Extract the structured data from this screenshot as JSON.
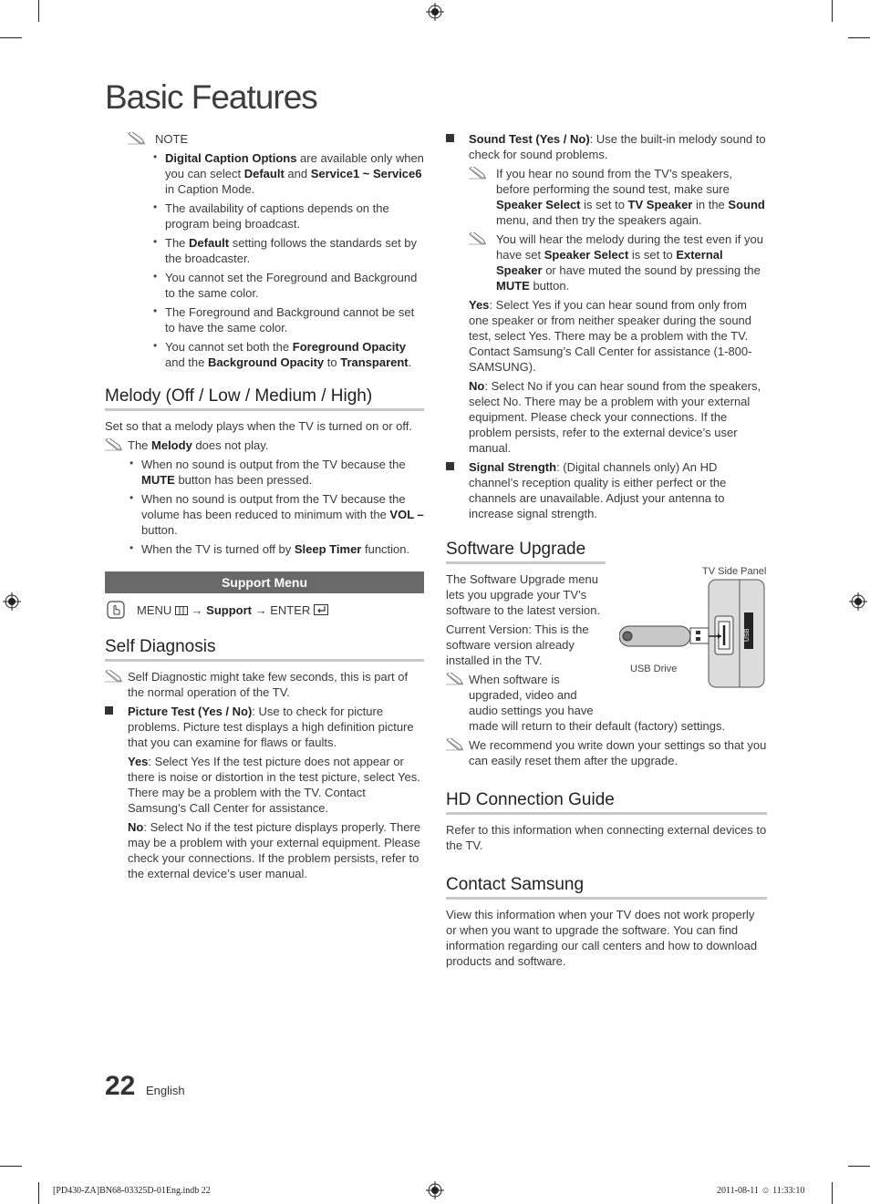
{
  "page": {
    "section_title": "Basic Features",
    "page_number": "22",
    "language": "English",
    "footer_file": "[PD430-ZA]BN68-03325D-01Eng.indb   22",
    "footer_timestamp": "2011-08-11   ☺ 11:33:10"
  },
  "left_column": {
    "note_heading": "NOTE",
    "note_bullets": [
      {
        "html": "<b>Digital Caption Options</b> are available only when you can select <b>Default</b> and <b>Service1 ~ Service6</b> in Caption Mode."
      },
      {
        "html": "The availability of captions depends on the program being broadcast."
      },
      {
        "html": "The <b>Default</b> setting follows the standards set by the broadcaster."
      },
      {
        "html": "You cannot set the Foreground and Background to the same color."
      },
      {
        "html": "The Foreground and Background cannot be set to have the same color."
      },
      {
        "html": "You cannot set both the <b>Foreground Opacity</b> and the <b>Background Opacity</b> to <b>Transparent</b>."
      }
    ],
    "melody": {
      "heading": "Melody (Off / Low / Medium / High)",
      "intro": "Set so that a melody plays when the TV is turned on or off.",
      "note_html": "The <b>Melody</b> does not play.",
      "bullets": [
        {
          "html": "When no sound is output from the TV because the <b>MUTE</b> button has been pressed."
        },
        {
          "html": "When no sound is output from the TV because the volume has been reduced to minimum with the <b>VOL –</b> button."
        },
        {
          "html": "When the TV is turned off by <b>Sleep Timer</b> function."
        }
      ]
    },
    "support_menu": {
      "bar_label": "Support Menu",
      "path_menu": "MENU",
      "path_arrow1": "→",
      "path_support": "Support",
      "path_arrow2": "→",
      "path_enter": "ENTER"
    },
    "self_diagnosis": {
      "heading": "Self Diagnosis",
      "note": "Self Diagnostic might take few seconds, this is part of the normal operation of the TV.",
      "picture_test_html": "<b>Picture Test (Yes / No)</b>: Use to check for picture problems. Picture test displays a high definition picture that you can examine for flaws or faults.",
      "yes_html": "<b>Yes</b>: Select Yes If the test picture does not appear or there is noise or distortion in the test picture, select Yes. There may be a problem with the TV. Contact Samsung’s Call Center for assistance.",
      "no_html": "<b>No</b>: Select No if the test picture displays properly. There may be a problem with your external equipment. Please check your connections. If the problem persists, refer to the external device’s user manual."
    }
  },
  "right_column": {
    "sound_test_html": "<b>Sound Test (Yes / No)</b>: Use the built-in melody sound to check for sound problems.",
    "sound_note1_html": "If you hear no sound from the TV’s speakers, before performing the sound test, make sure <b>Speaker Select</b> is set to <b>TV Speaker</b> in the <b>Sound</b> menu, and then try the speakers again.",
    "sound_note2_html": "You will hear the melody during the test even if you have set <b>Speaker Select</b> is set to <b>External Speaker</b> or have muted the sound by pressing the <b>MUTE</b> button.",
    "sound_yes_html": "<b>Yes</b>: Select Yes if you can hear sound from only from one speaker or from neither speaker during the sound test, select Yes. There may be a problem with the TV. Contact Samsung’s Call Center for assistance (1-800-SAMSUNG).",
    "sound_no_html": "<b>No</b>: Select No if you can hear sound from the speakers, select No. There may be a problem with your external equipment. Please check your connections. If the problem persists, refer to the external device’s user manual.",
    "signal_html": "<b>Signal Strength</b>: (Digital channels only) An HD channel’s reception quality is either perfect or the channels are unavailable. Adjust your antenna to increase signal strength.",
    "software_upgrade": {
      "heading": "Software Upgrade",
      "intro": "The Software Upgrade menu lets you upgrade your TV’s software to the latest version.",
      "current_version": "Current Version: This is the software version already installed in the TV.",
      "note1_a": "When software is upgraded, video and audio settings you have",
      "note1_b": "made will return to their default (factory) settings.",
      "note2": "We recommend you write down your settings so that you can easily reset them after the upgrade.",
      "figure_label_panel": "TV Side Panel",
      "figure_label_drive": "USB Drive",
      "figure_port_label": "USB"
    },
    "hd_guide": {
      "heading": "HD Connection Guide",
      "text": "Refer to this information when connecting external devices to the TV."
    },
    "contact": {
      "heading": "Contact Samsung",
      "text": "View this information when your TV does not work properly or when you want to upgrade the software. You can find information regarding our call centers and how to download products and software."
    }
  }
}
